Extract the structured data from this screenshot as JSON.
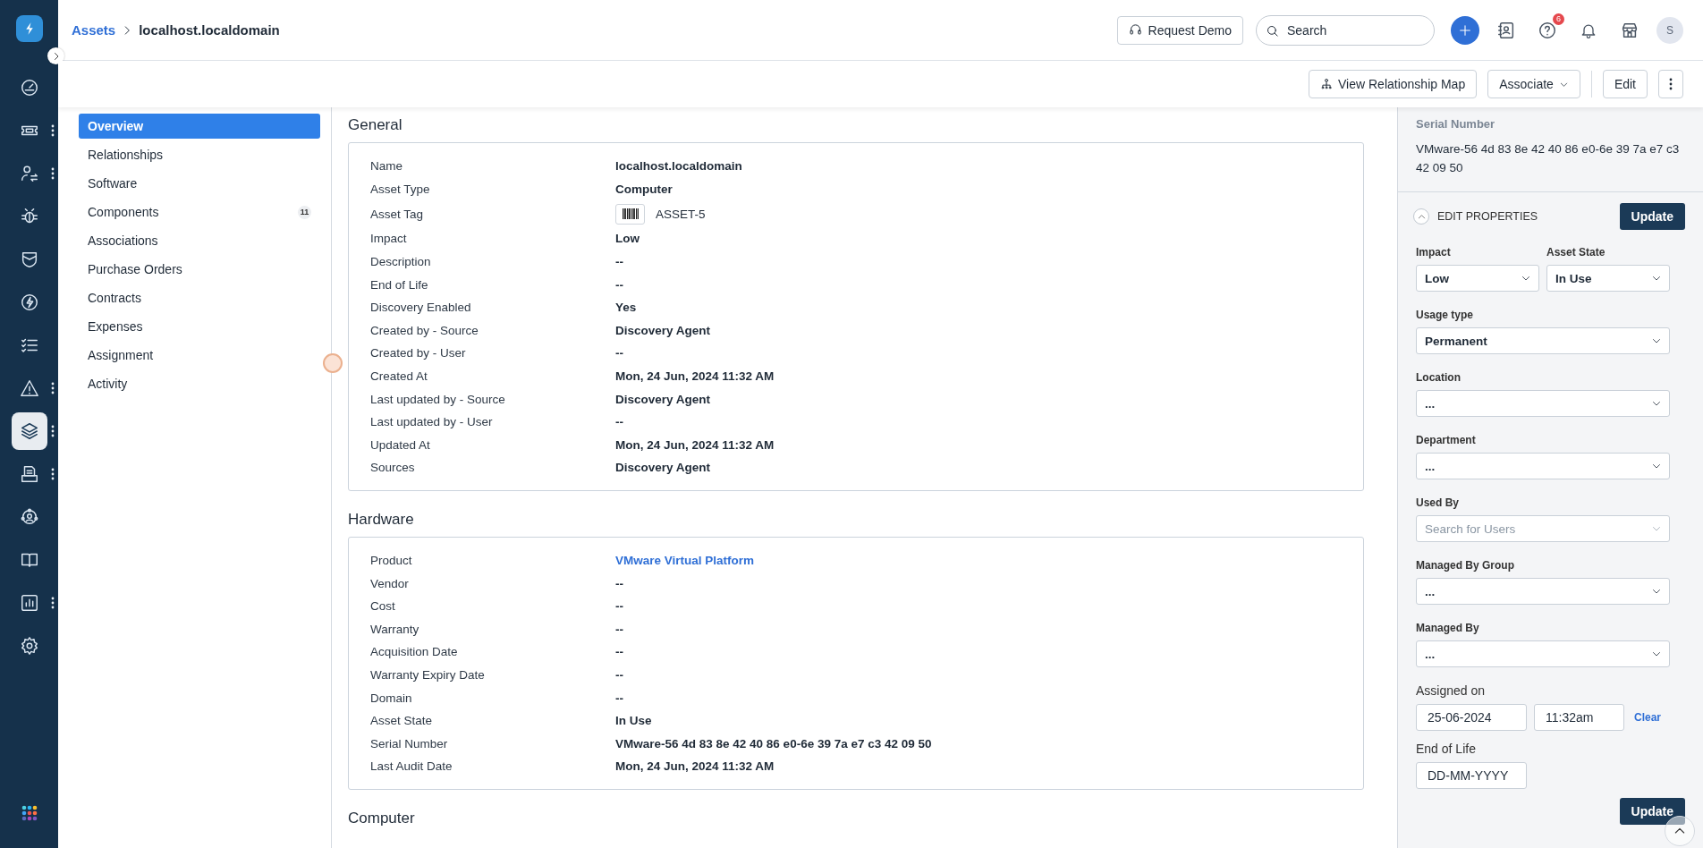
{
  "header": {
    "breadcrumb": [
      {
        "label": "Assets",
        "kind": "link"
      },
      {
        "label": "localhost.localdomain",
        "kind": "current"
      }
    ],
    "request_demo": "Request Demo",
    "search": {
      "placeholder": "Search"
    },
    "help_badge": "6",
    "avatar": "S"
  },
  "rail": {
    "items": [
      {
        "selected": false,
        "has_menu": false
      },
      {
        "selected": false,
        "has_menu": true
      },
      {
        "selected": false,
        "has_menu": true
      },
      {
        "selected": false,
        "has_menu": false
      },
      {
        "selected": false,
        "has_menu": false
      },
      {
        "selected": false,
        "has_menu": false
      },
      {
        "selected": false,
        "has_menu": false
      },
      {
        "selected": false,
        "has_menu": true
      },
      {
        "selected": true,
        "has_menu": true
      },
      {
        "selected": false,
        "has_menu": true
      },
      {
        "selected": false,
        "has_menu": false
      },
      {
        "selected": false,
        "has_menu": false
      },
      {
        "selected": false,
        "has_menu": true
      },
      {
        "selected": false,
        "has_menu": false
      }
    ]
  },
  "toolbar": {
    "buttons": [
      {
        "label": "View Relationship Map",
        "kind": "map"
      },
      {
        "label": "Associate",
        "kind": "dropdown"
      },
      {
        "label": "Edit",
        "kind": "plain"
      },
      {
        "kind": "more"
      }
    ]
  },
  "tabs": [
    {
      "label": "Overview",
      "selected": true
    },
    {
      "label": "Relationships",
      "selected": false
    },
    {
      "label": "Software",
      "selected": false
    },
    {
      "label": "Components",
      "selected": false,
      "count": "11"
    },
    {
      "label": "Associations",
      "selected": false
    },
    {
      "label": "Purchase Orders",
      "selected": false
    },
    {
      "label": "Contracts",
      "selected": false
    },
    {
      "label": "Expenses",
      "selected": false
    },
    {
      "label": "Assignment",
      "selected": false
    },
    {
      "label": "Activity",
      "selected": false
    }
  ],
  "sections": [
    {
      "title": "General",
      "rows": [
        {
          "label": "Name",
          "value": "localhost.localdomain",
          "kind": "text"
        },
        {
          "label": "Asset Type",
          "value": "Computer",
          "kind": "text"
        },
        {
          "label": "Asset Tag",
          "value": "ASSET-5",
          "kind": "tag"
        },
        {
          "label": "Impact",
          "value": "Low",
          "kind": "text"
        },
        {
          "label": "Description",
          "value": "--",
          "kind": "text"
        },
        {
          "label": "End of Life",
          "value": "--",
          "kind": "text"
        },
        {
          "label": "Discovery Enabled",
          "value": "Yes",
          "kind": "text"
        },
        {
          "label": "Created by - Source",
          "value": "Discovery Agent",
          "kind": "text"
        },
        {
          "label": "Created by - User",
          "value": "--",
          "kind": "text"
        },
        {
          "label": "Created At",
          "value": "Mon, 24 Jun, 2024 11:32 AM",
          "kind": "text"
        },
        {
          "label": "Last updated by - Source",
          "value": "Discovery Agent",
          "kind": "text"
        },
        {
          "label": "Last updated by - User",
          "value": "--",
          "kind": "text"
        },
        {
          "label": "Updated At",
          "value": "Mon, 24 Jun, 2024 11:32 AM",
          "kind": "text"
        },
        {
          "label": "Sources",
          "value": "Discovery Agent",
          "kind": "text"
        }
      ]
    },
    {
      "title": "Hardware",
      "rows": [
        {
          "label": "Product",
          "value": "VMware Virtual Platform",
          "kind": "link"
        },
        {
          "label": "Vendor",
          "value": "--",
          "kind": "text"
        },
        {
          "label": "Cost",
          "value": "--",
          "kind": "text"
        },
        {
          "label": "Warranty",
          "value": "--",
          "kind": "text"
        },
        {
          "label": "Acquisition Date",
          "value": "--",
          "kind": "text"
        },
        {
          "label": "Warranty Expiry Date",
          "value": "--",
          "kind": "text"
        },
        {
          "label": "Domain",
          "value": "--",
          "kind": "text"
        },
        {
          "label": "Asset State",
          "value": "In Use",
          "kind": "text"
        },
        {
          "label": "Serial Number",
          "value": "VMware-56 4d 83 8e 42 40 86 e0-6e 39 7a e7 c3 42 09 50",
          "kind": "text"
        },
        {
          "label": "Last Audit Date",
          "value": "Mon, 24 Jun, 2024 11:32 AM",
          "kind": "text"
        }
      ]
    },
    {
      "title": "Computer"
    }
  ],
  "side_panel": {
    "serial_label": "Serial Number",
    "serial_value": "VMware-56 4d 83 8e 42 40 86 e0-6e 39 7a e7 c3 42 09 50",
    "edit_title": "EDIT PROPERTIES",
    "expanded": true,
    "update_label": "Update",
    "field_rows": [
      [
        {
          "label": "Impact",
          "value": "Low",
          "kind": "select"
        },
        {
          "label": "Asset State",
          "value": "In Use",
          "kind": "select"
        }
      ],
      [
        {
          "label": "Usage type",
          "value": "Permanent",
          "kind": "select"
        }
      ],
      [
        {
          "label": "Location",
          "value": "...",
          "kind": "select"
        }
      ],
      [
        {
          "label": "Department",
          "value": "...",
          "kind": "select"
        }
      ],
      [
        {
          "label": "Used By",
          "placeholder": "Search for Users",
          "kind": "search"
        }
      ],
      [
        {
          "label": "Managed By Group",
          "value": "...",
          "kind": "select"
        }
      ],
      [
        {
          "label": "Managed By",
          "value": "...",
          "kind": "select"
        }
      ],
      [
        {
          "label": "Assigned on",
          "date": "25-06-2024",
          "time": "11:32am",
          "clear": "Clear",
          "kind": "datetime"
        }
      ],
      [
        {
          "label": "End of Life",
          "placeholder": "DD-MM-YYYY",
          "kind": "date"
        }
      ]
    ],
    "bottom_update_label": "Update"
  }
}
